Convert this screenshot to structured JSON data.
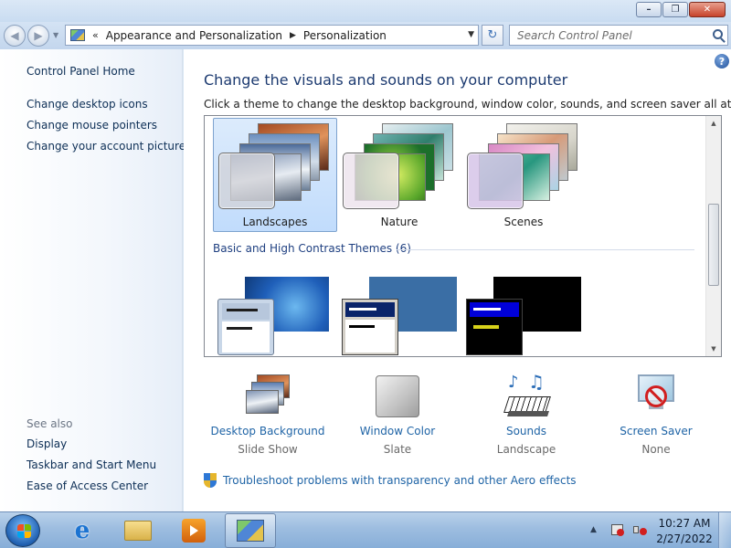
{
  "window": {
    "minimize_glyph": "–",
    "maximize_glyph": "❐",
    "close_glyph": "✕"
  },
  "nav": {
    "back_glyph": "◀",
    "forward_glyph": "▶",
    "dropdown_glyph": "▼",
    "refresh_glyph": "↻"
  },
  "breadcrumb": {
    "chevron": "«",
    "separator": "▶",
    "items": [
      "Appearance and Personalization",
      "Personalization"
    ]
  },
  "search": {
    "placeholder": "Search Control Panel"
  },
  "sidebar": {
    "home": "Control Panel Home",
    "links": [
      "Change desktop icons",
      "Change mouse pointers",
      "Change your account picture"
    ],
    "see_also_label": "See also",
    "see_also": [
      "Display",
      "Taskbar and Start Menu",
      "Ease of Access Center"
    ]
  },
  "main": {
    "help_glyph": "?",
    "title": "Change the visuals and sounds on your computer",
    "description": "Click a theme to change the desktop background, window color, sounds, and screen saver all at once.",
    "aero_themes": [
      {
        "name": "Landscapes",
        "selected": true
      },
      {
        "name": "Nature",
        "selected": false
      },
      {
        "name": "Scenes",
        "selected": false
      }
    ],
    "basic_group_label": "Basic and High Contrast Themes (6)",
    "scroll_up": "▲",
    "scroll_down": "▼"
  },
  "settings": [
    {
      "title": "Desktop Background",
      "value": "Slide Show",
      "icon": "desktop-background-icon"
    },
    {
      "title": "Window Color",
      "value": "Slate",
      "icon": "window-color-icon"
    },
    {
      "title": "Sounds",
      "value": "Landscape",
      "icon": "sounds-icon"
    },
    {
      "title": "Screen Saver",
      "value": "None",
      "icon": "screen-saver-icon"
    }
  ],
  "aero_link": "Troubleshoot problems with transparency and other Aero effects",
  "taskbar": {
    "tray_arrow": "▲",
    "time": "10:27 AM",
    "date": "2/27/2022"
  },
  "colors": {
    "link": "#1f64a6",
    "title": "#1c3a70",
    "selection": "#c1dcfc"
  }
}
